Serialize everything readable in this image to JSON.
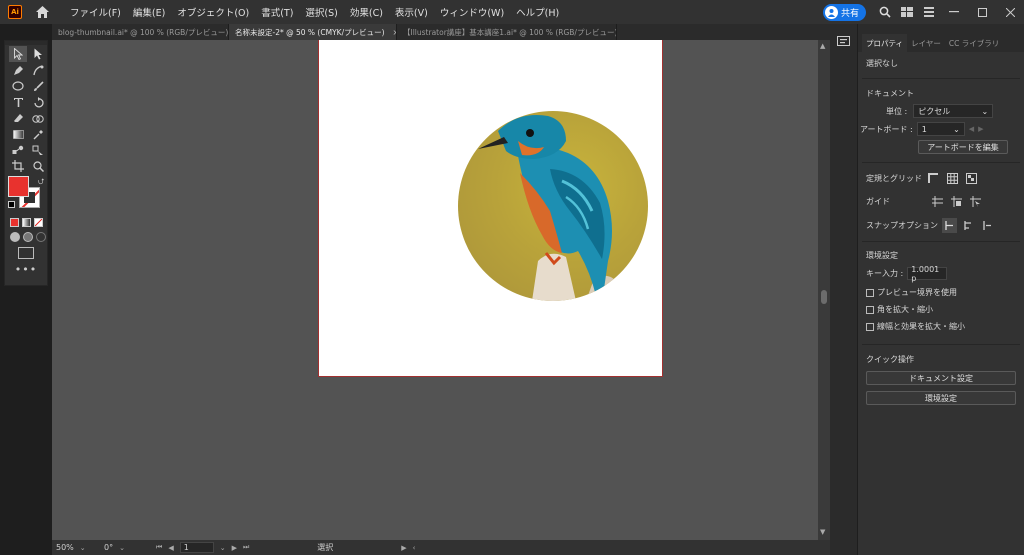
{
  "app": {
    "logo": "Ai"
  },
  "menus": [
    "ファイル(F)",
    "編集(E)",
    "オブジェクト(O)",
    "書式(T)",
    "選択(S)",
    "効果(C)",
    "表示(V)",
    "ウィンドウ(W)",
    "ヘルプ(H)"
  ],
  "header": {
    "share_label": "共有"
  },
  "tabs": [
    {
      "label": "blog-thumbnail.ai* @ 100 % (RGB/プレビュー)",
      "close": "×"
    },
    {
      "label": "名称未設定-2* @ 50 % (CMYK/プレビュー)",
      "close": "×"
    },
    {
      "label": "【Illustrator講座】基本講座1.ai* @ 100 % (RGB/プレビュー)",
      "close": "×"
    }
  ],
  "panel": {
    "tabs": [
      "プロパティ",
      "レイヤー",
      "CC ライブラリ"
    ],
    "selection": "選択なし",
    "document_heading": "ドキュメント",
    "unit_label": "単位 :",
    "unit_value": "ピクセル",
    "artboard_label": "アートボード :",
    "artboard_value": "1",
    "edit_artboard": "アートボードを編集",
    "rulers_grids": "定規とグリッド",
    "guides": "ガイド",
    "snap_options": "スナップオプション",
    "preferences_heading": "環境設定",
    "key_increment_label": "キー入力 :",
    "key_increment_value": "1.0001 p",
    "preview_bounds": "プレビュー境界を使用",
    "scale_corners": "角を拡大・縮小",
    "scale_strokes": "線幅と効果を拡大・縮小",
    "quick_actions": "クイック操作",
    "document_setup": "ドキュメント設定",
    "preferences_button": "環境設定"
  },
  "status": {
    "zoom": "50%",
    "rotation": "0°",
    "artboard_nav": "1",
    "tool_label": "選択"
  },
  "colors": {
    "fill": "#e8322e",
    "stroke": "#ffffff",
    "accent": "#1473e6"
  }
}
